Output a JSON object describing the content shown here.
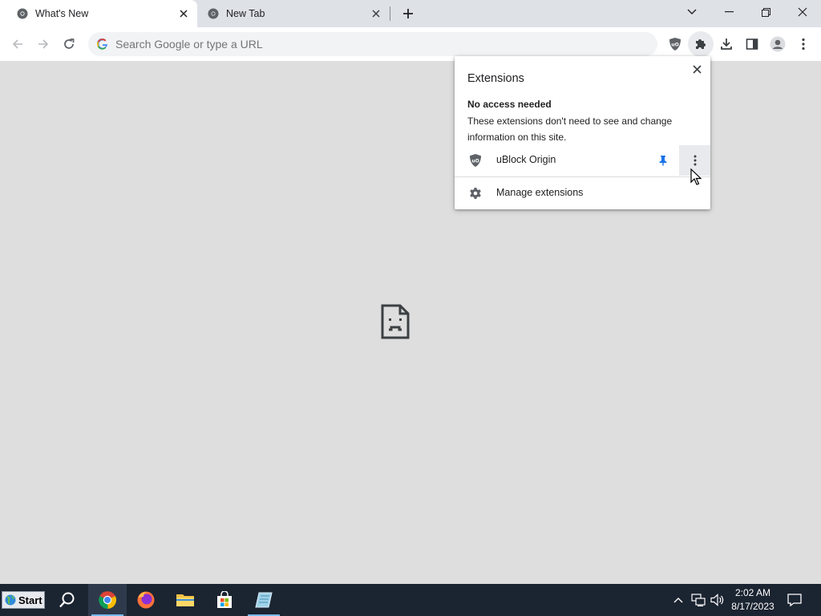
{
  "tabs": [
    {
      "title": "What's New",
      "active": true
    },
    {
      "title": "New Tab",
      "active": false
    }
  ],
  "omnibox": {
    "placeholder": "Search Google or type a URL"
  },
  "extensions_popup": {
    "title": "Extensions",
    "section_heading": "No access needed",
    "section_description": "These extensions don't need to see and change information on this site.",
    "extension_name": "uBlock Origin",
    "manage_label": "Manage extensions"
  },
  "taskbar": {
    "start_label": "Start",
    "time": "2:02 AM",
    "date": "8/17/2023"
  },
  "colors": {
    "tabstrip": "#dee1e6",
    "content_bg": "#dedede",
    "pin_blue": "#1a73e8",
    "taskbar": "#1b2431"
  }
}
